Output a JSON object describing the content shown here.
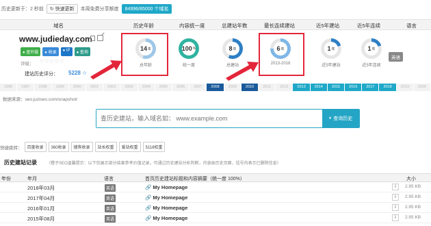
{
  "topbar": {
    "update_text": "历史更新于：2 秒前",
    "refresh_label": "↻ 快速更新",
    "note": "本周免费分享额度",
    "quota_label": "84996/85000 个域名"
  },
  "header": [
    "域名",
    "历史年龄",
    "内容统一度",
    "总建站年数",
    "最长连续建站",
    "近5年建站",
    "近5年连续",
    "语言"
  ],
  "domain": {
    "name": "www.judieday.com",
    "badges": [
      "● 查外链",
      "● 收录",
      "● IP",
      "● 查询"
    ],
    "meta_label": "评级：",
    "hearts": "♡♡♡♡♡ ·",
    "score_label": "建站历史评分：",
    "score_value": "5228 ☆"
  },
  "stats": [
    {
      "value": "14",
      "unit": "年",
      "caption": "总年龄",
      "fraction": 0.55,
      "color": "#9ec7e8"
    },
    {
      "value": "100",
      "unit": "%",
      "caption": "统一度",
      "fraction": 1.0,
      "color": "#2fb3a0"
    },
    {
      "value": "8",
      "unit": "年",
      "caption": "总建站",
      "fraction": 0.57,
      "color": "#2e7fc5"
    },
    {
      "value": "6",
      "unit": "年",
      "caption": "2013-2018",
      "fraction": 0.75,
      "color": "#7fb7e6"
    },
    {
      "value": "1",
      "unit": "年",
      "caption": "近5年建站",
      "fraction": 0.2,
      "color": "#2e7fc5"
    },
    {
      "value": "1",
      "unit": "年",
      "caption": "近5年连续",
      "fraction": 0.2,
      "color": "#2e7fc5"
    }
  ],
  "language_tag": "英语",
  "timeline": [
    {
      "y": "1996",
      "s": ""
    },
    {
      "y": "1997",
      "s": ""
    },
    {
      "y": "1998",
      "s": ""
    },
    {
      "y": "1999",
      "s": ""
    },
    {
      "y": "2000",
      "s": ""
    },
    {
      "y": "2001",
      "s": ""
    },
    {
      "y": "2002",
      "s": ""
    },
    {
      "y": "2003",
      "s": ""
    },
    {
      "y": "2004",
      "s": ""
    },
    {
      "y": "2005",
      "s": ""
    },
    {
      "y": "2006",
      "s": ""
    },
    {
      "y": "2007",
      "s": ""
    },
    {
      "y": "2008",
      "s": "dk"
    },
    {
      "y": "2009",
      "s": ""
    },
    {
      "y": "2010",
      "s": "dk"
    },
    {
      "y": "2011",
      "s": ""
    },
    {
      "y": "2012",
      "s": ""
    },
    {
      "y": "2013",
      "s": "tl"
    },
    {
      "y": "2014",
      "s": "tl"
    },
    {
      "y": "2015",
      "s": "tl"
    },
    {
      "y": "2016",
      "s": "tl"
    },
    {
      "y": "2017",
      "s": "tl"
    },
    {
      "y": "2018",
      "s": "tl"
    },
    {
      "y": "2019",
      "s": ""
    },
    {
      "y": "2020",
      "s": ""
    }
  ],
  "source_text": "数据来源：seo.juziseo.com/snapshot/",
  "search": {
    "placeholder": "查历史建站，输入域名如： www.example.com",
    "button": "查询历史"
  },
  "jump": {
    "label": "快捷跳转：",
    "buttons": [
      "百度收录",
      "360收录",
      "搜狗收录",
      "站长权重",
      "爱站权重",
      "5118权重"
    ]
  },
  "section": {
    "title": "历史建站记录",
    "note": "（橙子SEO温馨提示：以下仅展示部分结果参考价值记录，可通过历史建站分析判断，内容由历史页面，括号内表示已删除信息）"
  },
  "table": {
    "headers": [
      "年份",
      "年月",
      "语言",
      "首页历史建站标题和内容摘要（统一度 100%）",
      "大小"
    ],
    "rows": [
      {
        "ym": "2018年03月",
        "lang": "英语",
        "title": "🔗 My Homepage",
        "size": "2.95 KB"
      },
      {
        "ym": "2017年04月",
        "lang": "英语",
        "title": "🔗 My Homepage",
        "size": "2.95 KB"
      },
      {
        "ym": "2016年01月",
        "lang": "英语",
        "title": "🔗 My Homepage",
        "size": "2.95 KB"
      },
      {
        "ym": "2015年08月",
        "lang": "英语",
        "title": "🔗 My Homepage",
        "size": "2.95 KB"
      }
    ]
  }
}
